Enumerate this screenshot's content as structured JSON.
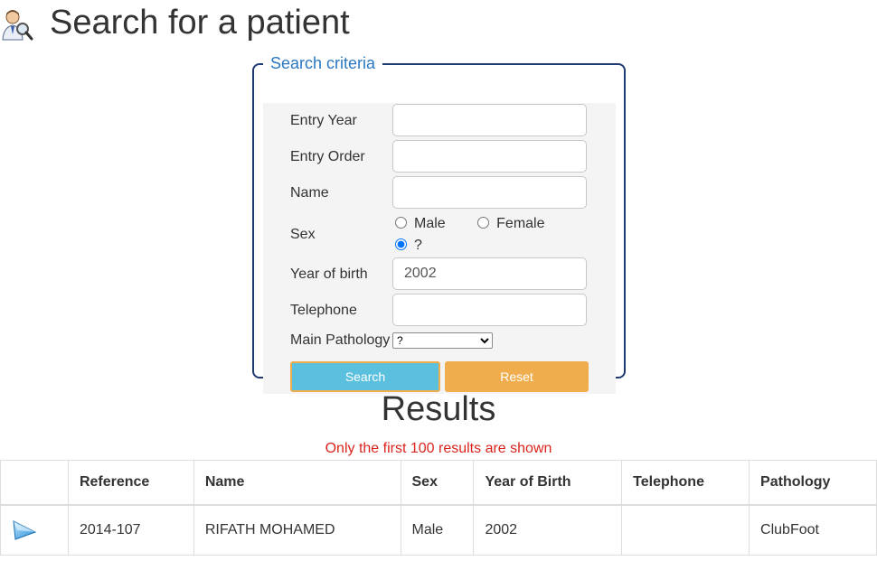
{
  "header": {
    "title": "Search for a patient",
    "icon": "patient-search-icon"
  },
  "criteria": {
    "legend": "Search criteria",
    "entry_year": {
      "label": "Entry Year",
      "value": ""
    },
    "entry_order": {
      "label": "Entry Order",
      "value": ""
    },
    "name": {
      "label": "Name",
      "value": ""
    },
    "sex": {
      "label": "Sex",
      "options": [
        "Male",
        "Female",
        "?"
      ],
      "selected": "?"
    },
    "year_of_birth": {
      "label": "Year of birth",
      "value": "2002"
    },
    "telephone": {
      "label": "Telephone",
      "value": ""
    },
    "main_pathology": {
      "label": "Main Pathology",
      "selected": "?"
    },
    "search_label": "Search",
    "reset_label": "Reset"
  },
  "results": {
    "title": "Results",
    "notice": "Only the first 100 results are shown",
    "columns": [
      "",
      "Reference",
      "Name",
      "Sex",
      "Year of Birth",
      "Telephone",
      "Pathology"
    ],
    "rows": [
      {
        "icon": "play-arrow-icon",
        "reference": "2014-107",
        "name": "RIFATH MOHAMED",
        "sex": "Male",
        "year_of_birth": "2002",
        "telephone": "",
        "pathology": "ClubFoot"
      }
    ]
  },
  "colors": {
    "legend": "#2b78c2",
    "fieldset_border": "#1f3b73",
    "search_button": "#5bc0de",
    "reset_button": "#f0ad4e",
    "notice": "#d9251d"
  }
}
